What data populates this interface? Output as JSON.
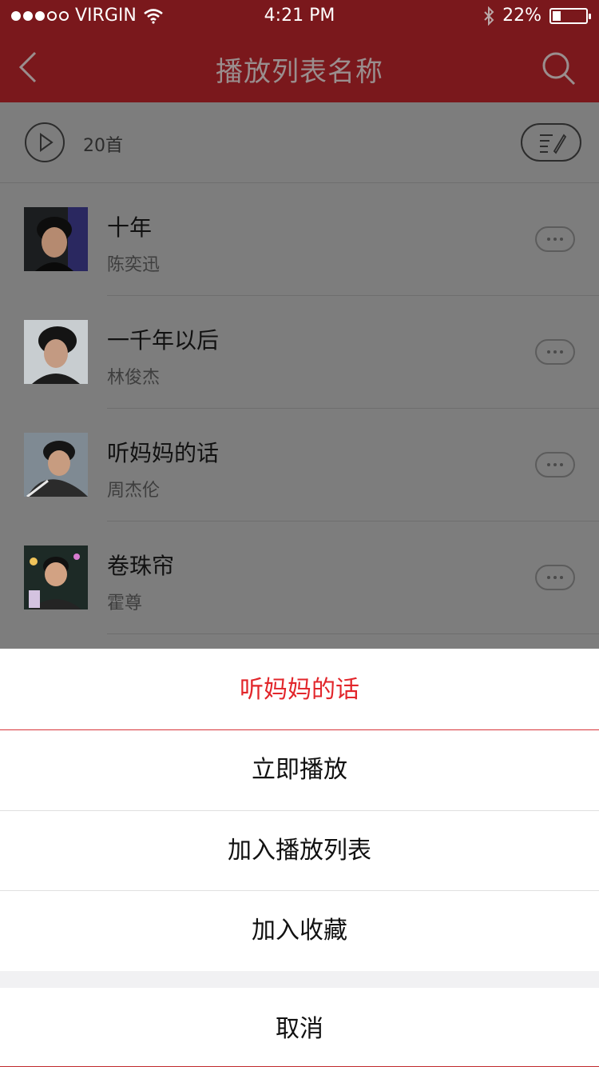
{
  "status_bar": {
    "carrier": "VIRGIN",
    "time": "4:21 PM",
    "battery_percent": "22%",
    "battery_level": 0.22,
    "signal_dots_filled": 3,
    "signal_dots_total": 5
  },
  "nav": {
    "title": "播放列表名称",
    "back_icon": "chevron-left-icon",
    "search_icon": "search-icon"
  },
  "header": {
    "count": "20首",
    "play_icon": "play-circle-icon",
    "edit_icon": "edit-list-icon"
  },
  "songs": [
    {
      "name": "十年",
      "artist": "陈奕迅"
    },
    {
      "name": "一千年以后",
      "artist": "林俊杰"
    },
    {
      "name": "听妈妈的话",
      "artist": "周杰伦"
    },
    {
      "name": "卷珠帘",
      "artist": "霍尊"
    }
  ],
  "sheet": {
    "title": "听妈妈的话",
    "play_now": "立即播放",
    "add_to_playlist": "加入播放列表",
    "add_to_favorites": "加入收藏",
    "cancel": "取消"
  },
  "colors": {
    "brand_red": "#7a181c",
    "accent_red": "#e2262b",
    "overlay_gray": "#7d7d7d"
  }
}
